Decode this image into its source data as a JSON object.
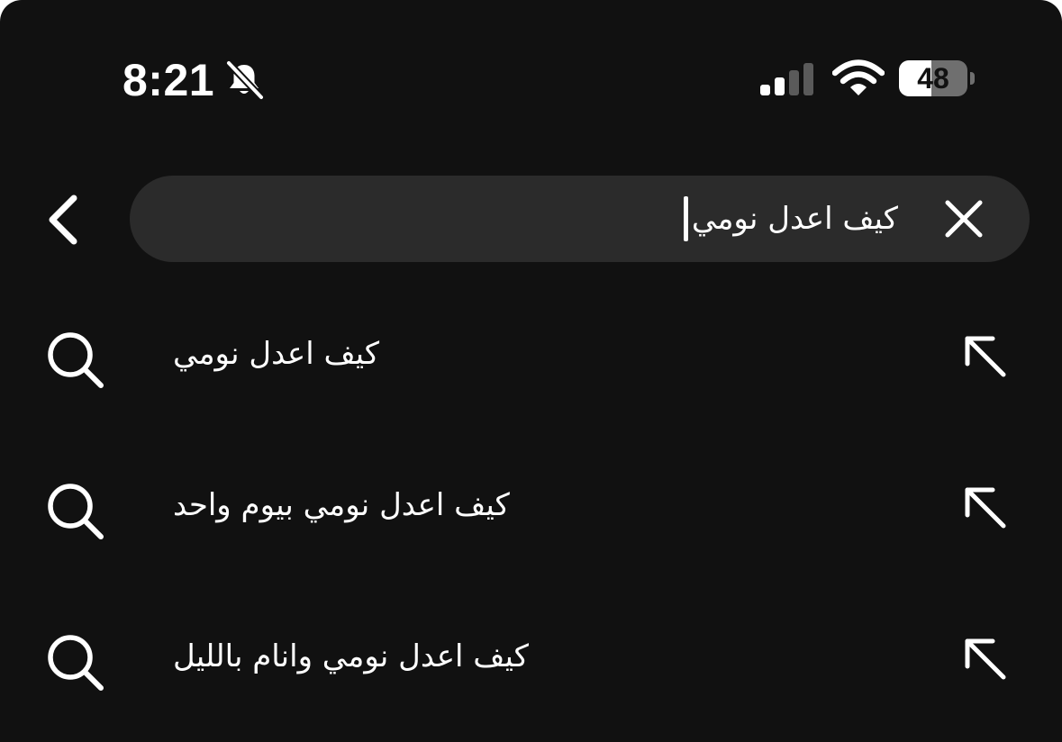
{
  "status_bar": {
    "time": "8:21",
    "silent_icon": "bell-slash-icon",
    "signal_icon": "cellular-signal-icon",
    "wifi_icon": "wifi-icon",
    "battery_percent": "48",
    "battery_level": 0.48
  },
  "search": {
    "back_icon": "chevron-left-icon",
    "query": "كيف اعدل نومي",
    "clear_icon": "close-icon"
  },
  "suggestions": [
    {
      "text": "كيف اعدل نومي",
      "icon": "search-icon",
      "action_icon": "arrow-up-left-icon"
    },
    {
      "text": "كيف اعدل نومي بيوم واحد",
      "icon": "search-icon",
      "action_icon": "arrow-up-left-icon"
    },
    {
      "text": "كيف اعدل نومي وانام بالليل",
      "icon": "search-icon",
      "action_icon": "arrow-up-left-icon"
    }
  ],
  "colors": {
    "background": "#111111",
    "search_field": "#2b2b2b",
    "text": "#ffffff"
  }
}
